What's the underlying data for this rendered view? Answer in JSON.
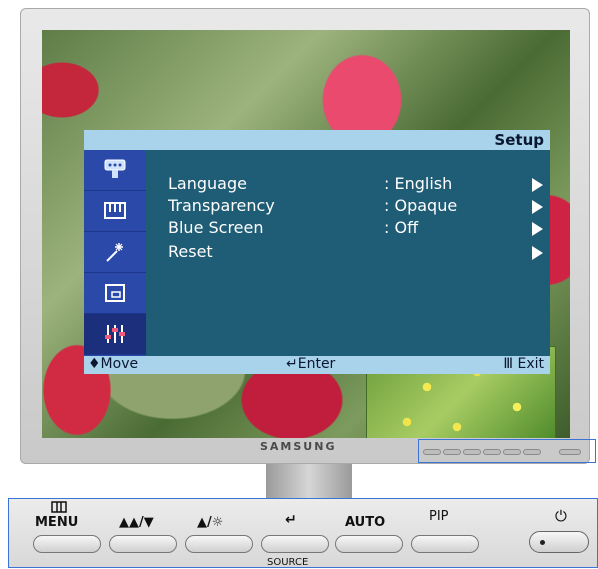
{
  "osd": {
    "title": "Setup",
    "tabs": [
      {
        "icon": "input-icon"
      },
      {
        "icon": "picture-icon"
      },
      {
        "icon": "magic-icon"
      },
      {
        "icon": "window-icon"
      },
      {
        "icon": "setup-sliders-icon",
        "active": true
      }
    ],
    "rows": [
      {
        "label": "Language",
        "value": ": English"
      },
      {
        "label": "Transparency",
        "value": ": Opaque"
      },
      {
        "label": "Blue Screen",
        "value": ": Off"
      },
      {
        "label": "Reset",
        "value": ""
      }
    ],
    "footer": {
      "move": "♦Move",
      "enter": "↵Enter",
      "exit": "Ⅲ Exit"
    }
  },
  "monitor": {
    "brand": "SAMSUNG"
  },
  "controls": {
    "menu": "MENU",
    "brightness_down": "▲▲/▼",
    "up_brightness": "▲/☼",
    "source_icon": "↵",
    "auto": "AUTO",
    "pip": "PIP",
    "power_icon": "⏻",
    "source_label": "SOURCE"
  },
  "colors": {
    "osd_panel": "#1f5c75",
    "osd_tabs": "#2a49a8",
    "osd_bar": "#a9d3ea",
    "highlight": "#3a74d4"
  }
}
